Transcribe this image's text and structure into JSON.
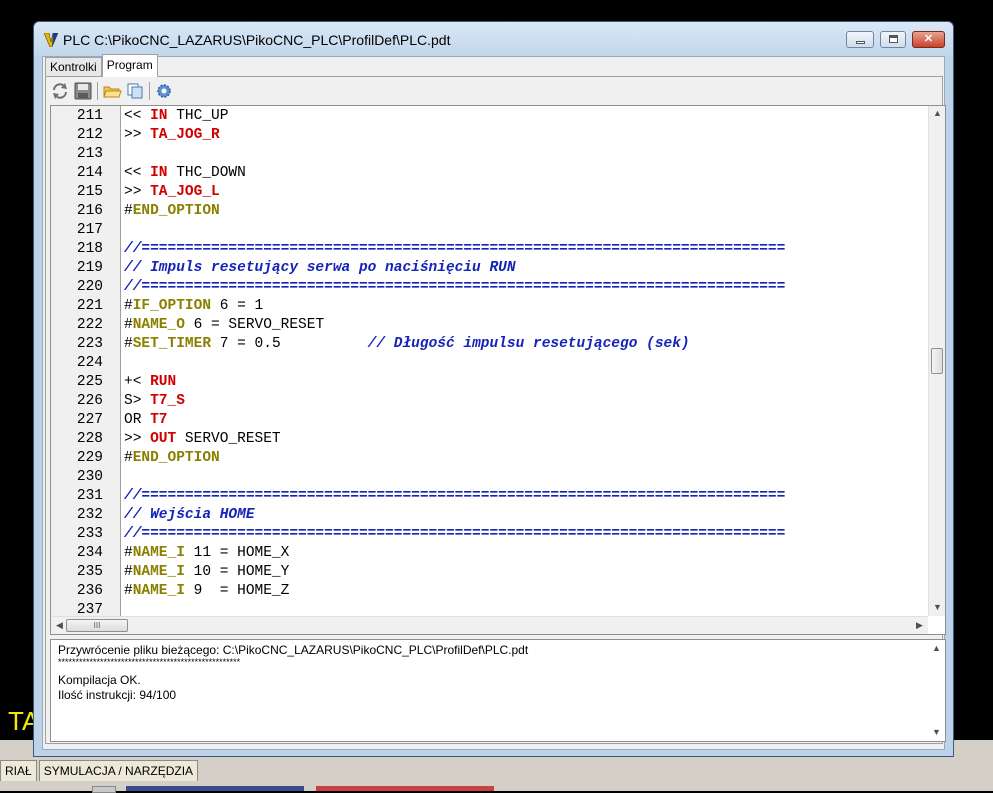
{
  "window": {
    "title": "PLC C:\\PikoCNC_LAZARUS\\PikoCNC_PLC\\ProfilDef\\PLC.pdt"
  },
  "tabs": [
    {
      "label": "Kontrolki",
      "active": false
    },
    {
      "label": "Program",
      "active": true
    }
  ],
  "toolbar": {
    "icons": [
      "refresh-icon",
      "save-icon",
      "open-folder-icon",
      "copy-icon",
      "settings-gear-icon"
    ]
  },
  "editor": {
    "lines": [
      {
        "num": "211",
        "tokens": [
          {
            "t": "<< ",
            "c": "plain"
          },
          {
            "t": "IN",
            "c": "kw"
          },
          {
            "t": " THC_UP",
            "c": "plain"
          }
        ]
      },
      {
        "num": "212",
        "tokens": [
          {
            "t": ">> ",
            "c": "plain"
          },
          {
            "t": "TA_JOG_R",
            "c": "kw"
          }
        ]
      },
      {
        "num": "213",
        "tokens": []
      },
      {
        "num": "214",
        "tokens": [
          {
            "t": "<< ",
            "c": "plain"
          },
          {
            "t": "IN",
            "c": "kw"
          },
          {
            "t": " THC_DOWN",
            "c": "plain"
          }
        ]
      },
      {
        "num": "215",
        "tokens": [
          {
            "t": ">> ",
            "c": "plain"
          },
          {
            "t": "TA_JOG_L",
            "c": "kw"
          }
        ]
      },
      {
        "num": "216",
        "tokens": [
          {
            "t": "#",
            "c": "plain"
          },
          {
            "t": "END_OPTION",
            "c": "dir"
          }
        ]
      },
      {
        "num": "217",
        "tokens": []
      },
      {
        "num": "218",
        "tokens": [
          {
            "t": "//==========================================================================",
            "c": "cmt"
          }
        ]
      },
      {
        "num": "219",
        "tokens": [
          {
            "t": "// Impuls resetujący serwa po naciśnięciu RUN",
            "c": "cmt"
          }
        ]
      },
      {
        "num": "220",
        "tokens": [
          {
            "t": "//==========================================================================",
            "c": "cmt"
          }
        ]
      },
      {
        "num": "221",
        "tokens": [
          {
            "t": "#",
            "c": "plain"
          },
          {
            "t": "IF_OPTION",
            "c": "dir"
          },
          {
            "t": " 6 = 1",
            "c": "plain"
          }
        ]
      },
      {
        "num": "222",
        "tokens": [
          {
            "t": "#",
            "c": "plain"
          },
          {
            "t": "NAME_O",
            "c": "dir"
          },
          {
            "t": " 6 = SERVO_RESET",
            "c": "plain"
          }
        ]
      },
      {
        "num": "223",
        "tokens": [
          {
            "t": "#",
            "c": "plain"
          },
          {
            "t": "SET_TIMER",
            "c": "dir"
          },
          {
            "t": " 7 = 0.5          ",
            "c": "plain"
          },
          {
            "t": "// Długość impulsu resetującego (sek)",
            "c": "cmt"
          }
        ]
      },
      {
        "num": "224",
        "tokens": []
      },
      {
        "num": "225",
        "tokens": [
          {
            "t": "+< ",
            "c": "plain"
          },
          {
            "t": "RUN",
            "c": "kw"
          }
        ]
      },
      {
        "num": "226",
        "tokens": [
          {
            "t": "S> ",
            "c": "plain"
          },
          {
            "t": "T7_S",
            "c": "kw"
          }
        ]
      },
      {
        "num": "227",
        "tokens": [
          {
            "t": "OR ",
            "c": "plain"
          },
          {
            "t": "T7",
            "c": "kw"
          }
        ]
      },
      {
        "num": "228",
        "tokens": [
          {
            "t": ">> ",
            "c": "plain"
          },
          {
            "t": "OUT",
            "c": "kw"
          },
          {
            "t": " SERVO_RESET",
            "c": "plain"
          }
        ]
      },
      {
        "num": "229",
        "tokens": [
          {
            "t": "#",
            "c": "plain"
          },
          {
            "t": "END_OPTION",
            "c": "dir"
          }
        ]
      },
      {
        "num": "230",
        "tokens": []
      },
      {
        "num": "231",
        "tokens": [
          {
            "t": "//==========================================================================",
            "c": "cmt"
          }
        ]
      },
      {
        "num": "232",
        "tokens": [
          {
            "t": "// Wejścia HOME",
            "c": "cmt"
          }
        ]
      },
      {
        "num": "233",
        "tokens": [
          {
            "t": "//==========================================================================",
            "c": "cmt"
          }
        ]
      },
      {
        "num": "234",
        "tokens": [
          {
            "t": "#",
            "c": "plain"
          },
          {
            "t": "NAME_I",
            "c": "dir"
          },
          {
            "t": " 11 = HOME_X",
            "c": "plain"
          }
        ]
      },
      {
        "num": "235",
        "tokens": [
          {
            "t": "#",
            "c": "plain"
          },
          {
            "t": "NAME_I",
            "c": "dir"
          },
          {
            "t": " 10 = HOME_Y",
            "c": "plain"
          }
        ]
      },
      {
        "num": "236",
        "tokens": [
          {
            "t": "#",
            "c": "plain"
          },
          {
            "t": "NAME_I",
            "c": "dir"
          },
          {
            "t": " 9  = HOME_Z",
            "c": "plain"
          }
        ]
      },
      {
        "num": "237",
        "tokens": []
      }
    ],
    "hscroll_thumb": "III"
  },
  "messages": [
    "Przywrócenie pliku bieżącego: C:\\PikoCNC_LAZARUS\\PikoCNC_PLC\\ProfilDef\\PLC.pdt",
    "****************************************************",
    "Kompilacja OK.",
    "Ilość instrukcji: 94/100"
  ],
  "background_app": {
    "yellow_text": "TA",
    "bottom_tabs": [
      "RIAŁ",
      "SYMULACJA / NARZĘDZIA"
    ]
  },
  "colors": {
    "keyword": "#d00000",
    "directive": "#8a8000",
    "comment": "#1424b8",
    "background_text": "#f5e90a"
  }
}
